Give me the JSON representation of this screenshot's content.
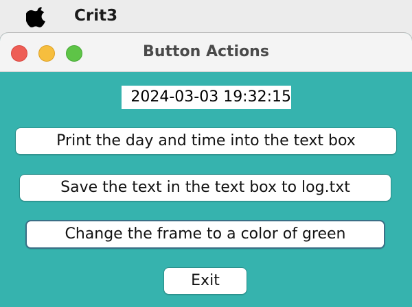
{
  "menubar": {
    "app_name": "Crit3"
  },
  "window": {
    "title": "Button Actions"
  },
  "textbox": {
    "value": "2024-03-03 19:32:15"
  },
  "buttons": {
    "print_label": "Print the day and time into the text box",
    "save_label": "Save the text in the text box to log.txt",
    "green_label": "Change the frame to a color of green",
    "exit_label": "Exit"
  },
  "colors": {
    "frame_background": "#36b3ae",
    "close": "#ee5e56",
    "minimize": "#f6be3e",
    "maximize": "#5ec447"
  }
}
